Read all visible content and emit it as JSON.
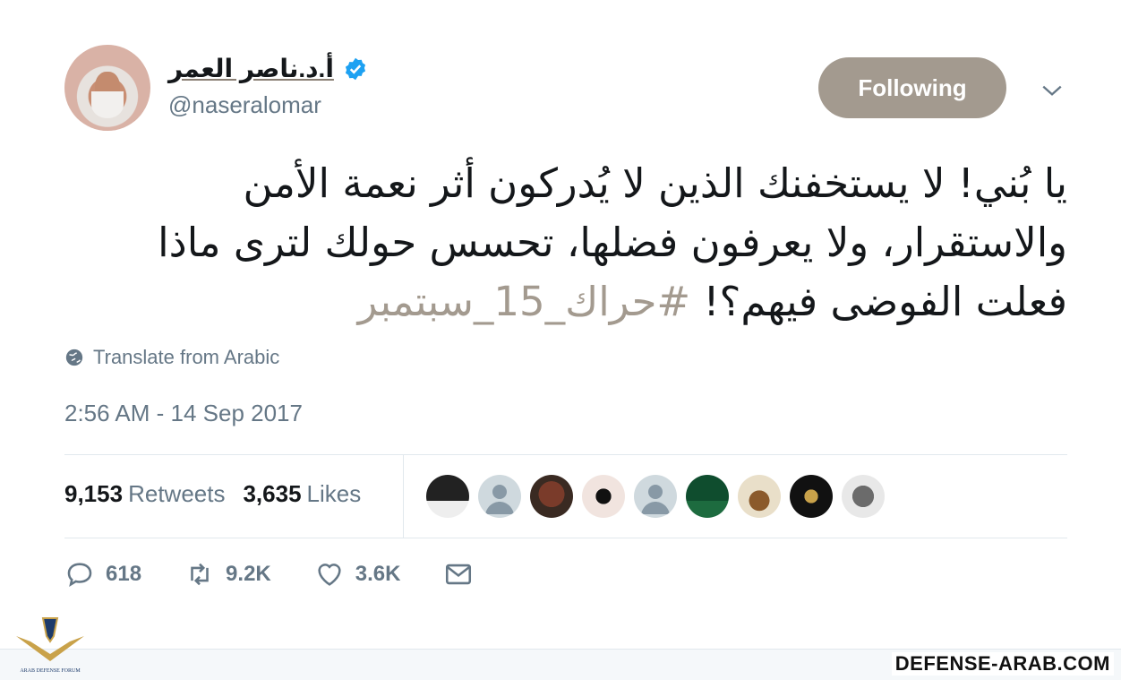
{
  "user": {
    "display_name": "أ.د.ناصر العمر",
    "handle": "@naseralomar",
    "verified": true
  },
  "follow_button": {
    "label": "Following"
  },
  "tweet": {
    "text": "يا بُني! لا يستخفنك الذين لا يُدركون أثر نعمة الأمن والاستقرار، ولا يعرفون فضلها، تحسس حولك لترى ماذا فعلت الفوضى فيهم؟!",
    "hashtag": "#حراك_15_سبتمبر"
  },
  "translate": {
    "label": "Translate from Arabic"
  },
  "timestamp": "2:56 AM - 14 Sep 2017",
  "stats": {
    "retweets_count": "9,153",
    "retweets_label": "Retweets",
    "likes_count": "3,635",
    "likes_label": "Likes"
  },
  "actions": {
    "replies": "618",
    "retweets": "9.2K",
    "likes": "3.6K"
  },
  "watermark": {
    "site": "DEFENSE-ARAB.COM",
    "logo_text": "ARAB DEFENSE FORUM"
  },
  "colors": {
    "accent": "#a39a8f",
    "muted": "#657786",
    "verified": "#1da1f2"
  }
}
